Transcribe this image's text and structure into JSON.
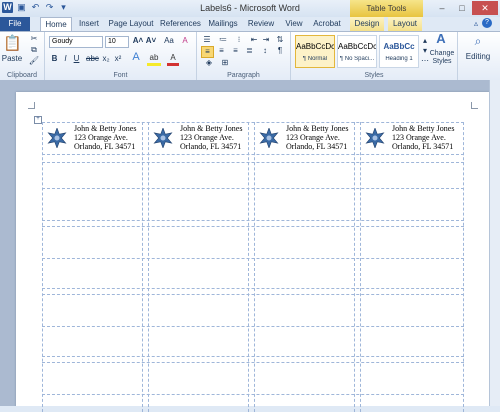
{
  "window": {
    "title": "Labels6 - Microsoft Word",
    "context_tab_group": "Table Tools"
  },
  "tabs": [
    "File",
    "Home",
    "Insert",
    "Page Layout",
    "References",
    "Mailings",
    "Review",
    "View",
    "Acrobat",
    "Design",
    "Layout"
  ],
  "ribbon": {
    "clipboard": {
      "paste": "Paste",
      "group_label": "Clipboard"
    },
    "font": {
      "family": "Goudy",
      "size": "10",
      "group_label": "Font"
    },
    "paragraph": {
      "group_label": "Paragraph"
    },
    "styles": {
      "group_label": "Styles",
      "tiles": [
        {
          "preview": "AaBbCcDc",
          "name": "¶ Normal"
        },
        {
          "preview": "AaBbCcDc",
          "name": "¶ No Spaci..."
        },
        {
          "preview": "AaBbCc",
          "name": "Heading 1"
        }
      ],
      "change_styles": "Change Styles",
      "editing": "Editing"
    }
  },
  "labels": [
    {
      "line1": "John & Betty Jones",
      "line2": "123 Orange Ave.",
      "line3": "Orlando, FL 34571"
    },
    {
      "line1": "John & Betty Jones",
      "line2": "123 Orange Ave.",
      "line3": "Orlando, FL 34571"
    },
    {
      "line1": "John & Betty Jones",
      "line2": "123 Orange Ave.",
      "line3": "Orlando, FL 34571"
    },
    {
      "line1": "John & Betty Jones",
      "line2": "123 Orange Ave.",
      "line3": "Orlando, FL 34571"
    }
  ],
  "colors": {
    "accent": "#2b579a",
    "table_tools": "#e8c440",
    "star_fill": "#3a6aa5"
  }
}
